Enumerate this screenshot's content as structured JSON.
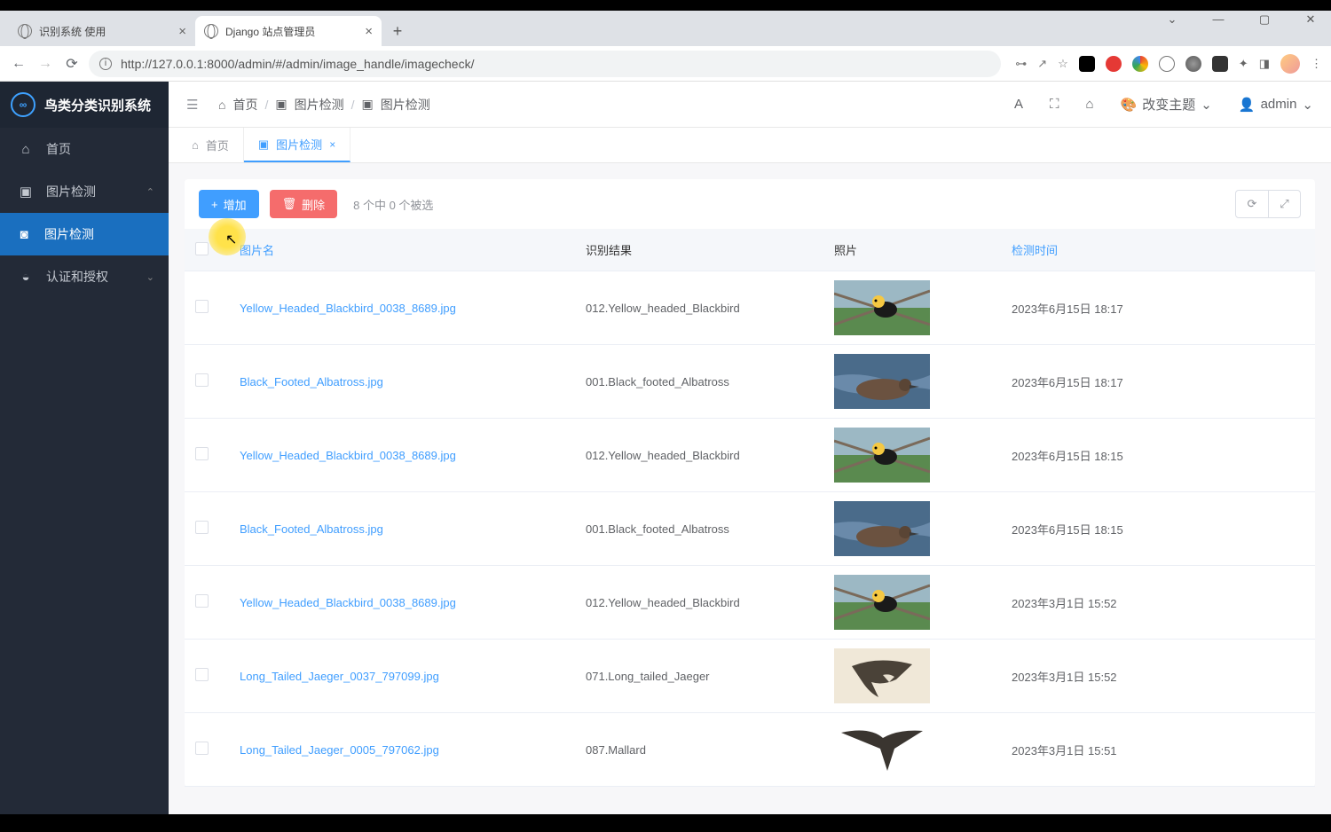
{
  "browser": {
    "tabs": [
      {
        "title": "识别系统 使用",
        "active": false
      },
      {
        "title": "Django 站点管理员",
        "active": true
      }
    ],
    "url": "http://127.0.0.1:8000/admin/#/admin/image_handle/imagecheck/"
  },
  "app": {
    "title": "鸟类分类识别系统",
    "sidebar": {
      "items": [
        {
          "label": "首页",
          "icon": "home"
        },
        {
          "label": "图片检测",
          "icon": "image",
          "expandable": true,
          "expanded": true
        },
        {
          "label": "图片检测",
          "icon": "camera",
          "sub": true,
          "active": true
        },
        {
          "label": "认证和授权",
          "icon": "shield",
          "expandable": true
        }
      ]
    },
    "breadcrumb": [
      "首页",
      "图片检测",
      "图片检测"
    ],
    "topbarRight": {
      "theme": "改变主题",
      "user": "admin"
    },
    "pageTabs": [
      {
        "label": "首页",
        "active": false
      },
      {
        "label": "图片检测",
        "active": true,
        "closable": true
      }
    ],
    "toolbar": {
      "add": "增加",
      "delete": "删除",
      "selection": "8 个中 0 个被选"
    },
    "table": {
      "columns": [
        "图片名",
        "识别结果",
        "照片",
        "检测时间"
      ],
      "rows": [
        {
          "name": "Yellow_Headed_Blackbird_0038_8689.jpg",
          "result": "012.Yellow_headed_Blackbird",
          "thumb": "blackbird",
          "time": "2023年6月15日 18:17"
        },
        {
          "name": "Black_Footed_Albatross.jpg",
          "result": "001.Black_footed_Albatross",
          "thumb": "albatross",
          "time": "2023年6月15日 18:17"
        },
        {
          "name": "Yellow_Headed_Blackbird_0038_8689.jpg",
          "result": "012.Yellow_headed_Blackbird",
          "thumb": "blackbird",
          "time": "2023年6月15日 18:15"
        },
        {
          "name": "Black_Footed_Albatross.jpg",
          "result": "001.Black_footed_Albatross",
          "thumb": "albatross",
          "time": "2023年6月15日 18:15"
        },
        {
          "name": "Yellow_Headed_Blackbird_0038_8689.jpg",
          "result": "012.Yellow_headed_Blackbird",
          "thumb": "blackbird",
          "time": "2023年3月1日 15:52"
        },
        {
          "name": "Long_Tailed_Jaeger_0037_797099.jpg",
          "result": "071.Long_tailed_Jaeger",
          "thumb": "jaeger1",
          "time": "2023年3月1日 15:52"
        },
        {
          "name": "Long_Tailed_Jaeger_0005_797062.jpg",
          "result": "087.Mallard",
          "thumb": "jaeger2",
          "time": "2023年3月1日 15:51"
        }
      ]
    }
  }
}
